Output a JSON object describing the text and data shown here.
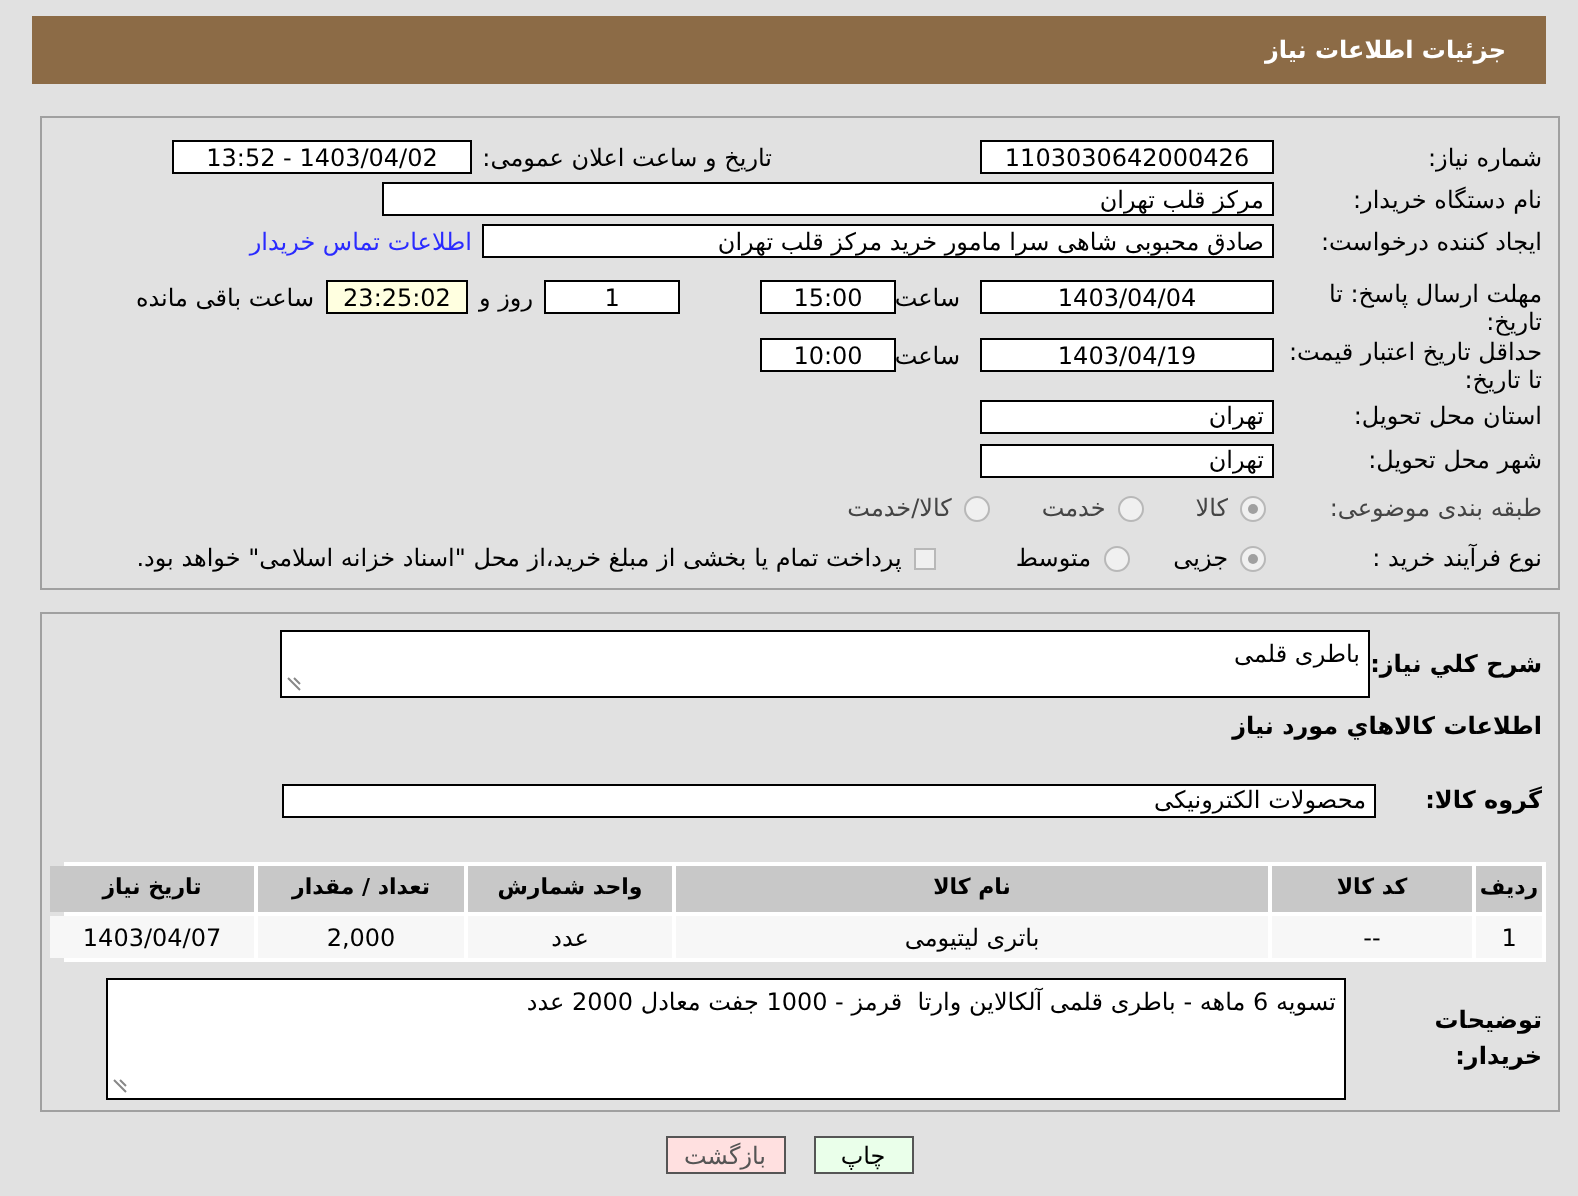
{
  "header": {
    "title": "جزئیات اطلاعات نیاز"
  },
  "need_number": {
    "label": "شماره نیاز:",
    "value": "1103030642000426"
  },
  "announce": {
    "label": "تاریخ و ساعت اعلان عمومی:",
    "value": "1403/04/02 - 13:52"
  },
  "buyer_org": {
    "label": "نام دستگاه خریدار:",
    "value": "مرکز قلب تهران"
  },
  "requester": {
    "label": "ایجاد کننده درخواست:",
    "value": "صادق محبوبی شاهی سرا مامور خرید مرکز قلب تهران",
    "contact_link": "اطلاعات تماس خریدار"
  },
  "deadline": {
    "label": "مهلت ارسال پاسخ: تا تاریخ:",
    "date": "1403/04/04",
    "time_label": "ساعت",
    "time": "15:00",
    "days": "1",
    "days_label": "روز و",
    "remaining": "23:25:02",
    "remaining_label": "ساعت باقی مانده"
  },
  "price_validity": {
    "label": "حداقل تاریخ اعتبار قیمت: تا تاریخ:",
    "date": "1403/04/19",
    "time_label": "ساعت",
    "time": "10:00"
  },
  "province": {
    "label": "استان محل تحویل:",
    "value": "تهران"
  },
  "city": {
    "label": "شهر محل تحویل:",
    "value": "تهران"
  },
  "category": {
    "label": "طبقه بندی موضوعی:",
    "options": [
      {
        "label": "کالا",
        "selected": true
      },
      {
        "label": "خدمت",
        "selected": false
      },
      {
        "label": "کالا/خدمت",
        "selected": false
      }
    ]
  },
  "process": {
    "label": "نوع فرآیند خرید :",
    "options": [
      {
        "label": "جزیی",
        "selected": true
      },
      {
        "label": "متوسط",
        "selected": false
      }
    ],
    "checkbox": {
      "checked": false,
      "label": "پرداخت تمام یا بخشی از مبلغ خرید،از محل \"اسناد خزانه اسلامی\" خواهد بود."
    }
  },
  "description": {
    "label": "شرح کلي نياز:",
    "value": "باطری قلمی"
  },
  "items_heading": "اطلاعات کالاهاي مورد نياز",
  "goods_group": {
    "label": "گروه کالا:",
    "value": "محصولات الکترونیکی"
  },
  "table": {
    "columns": [
      "ردیف",
      "کد کالا",
      "نام کالا",
      "واحد شمارش",
      "تعداد / مقدار",
      "تاریخ نیاز"
    ],
    "rows": [
      [
        "1",
        "--",
        "باتری لیتیومی",
        "عدد",
        "2,000",
        "1403/04/07"
      ]
    ]
  },
  "buyer_notes": {
    "label": "توضیحات خریدار:",
    "value": "تسویه 6 ماهه - باطری قلمی آلکالاین وارتا  قرمز - 1000 جفت معادل 2000 عدد"
  },
  "buttons": [
    {
      "label": "چاپ",
      "kind": "print"
    },
    {
      "label": "بازگشت",
      "kind": "back"
    }
  ]
}
